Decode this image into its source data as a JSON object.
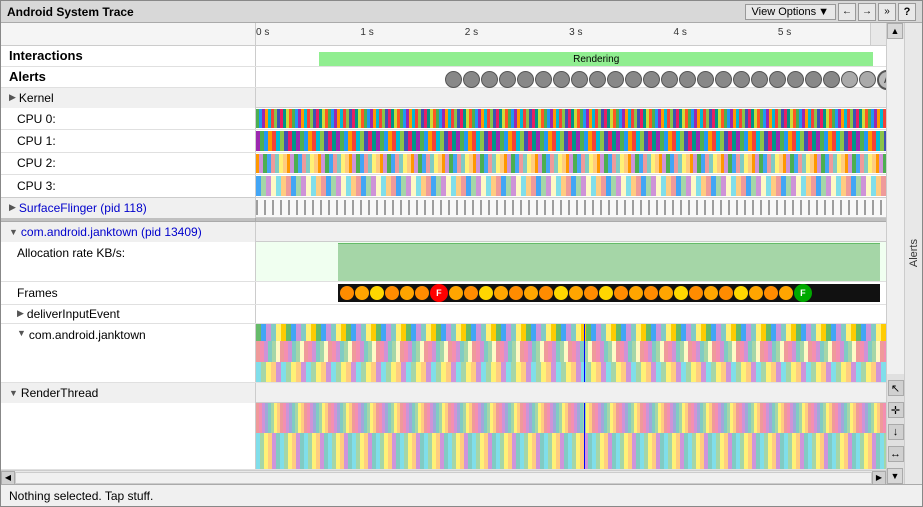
{
  "app": {
    "title": "Android System Trace"
  },
  "toolbar": {
    "view_options": "View Options",
    "view_options_arrow": "▼",
    "nav_back": "←",
    "nav_forward": "→",
    "nav_more": "»",
    "help": "?"
  },
  "timeline": {
    "ticks": [
      "0 s",
      "1 s",
      "2 s",
      "3 s",
      "4 s",
      "5 s"
    ]
  },
  "sections": {
    "interactions": "Interactions",
    "alerts": "Alerts",
    "kernel": "Kernel",
    "cpu0": "CPU 0:",
    "cpu1": "CPU 1:",
    "cpu2": "CPU 2:",
    "cpu3": "CPU 3:",
    "surfaceflinger": "SurfaceFlinger (pid 118)",
    "comandroid_janktown": "com.android.janktown (pid 13409)",
    "allocation_rate": "Allocation rate KB/s:",
    "frames": "Frames",
    "deliverInputEvent": "deliverInputEvent",
    "com_android_janktown": "com.android.janktown",
    "render_thread": "RenderThread"
  },
  "tracks": {
    "rendering_label": "Rendering"
  },
  "status": {
    "message": "Nothing selected. Tap stuff."
  },
  "sidebar_alerts": "Alerts"
}
